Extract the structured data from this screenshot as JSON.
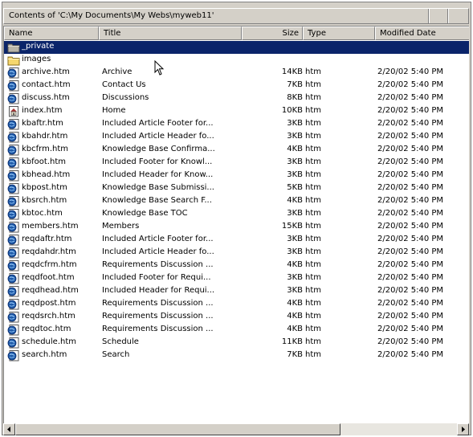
{
  "window": {
    "title": "Contents of 'C:\\My Documents\\My Webs\\myweb11'"
  },
  "columns": {
    "name": "Name",
    "title": "Title",
    "size": "Size",
    "type": "Type",
    "modified": "Modified Date"
  },
  "colors": {
    "selection": "#0a246a",
    "face": "#d4d0c8",
    "folder": "#f5d76e",
    "page_icon": "#1e5aa8"
  },
  "rows": [
    {
      "icon": "folder-private-icon",
      "name": "_private",
      "title": "",
      "size": "",
      "type": "",
      "modified": "",
      "selected": true
    },
    {
      "icon": "folder-icon",
      "name": "images",
      "title": "",
      "size": "",
      "type": "",
      "modified": ""
    },
    {
      "icon": "html-page-icon",
      "name": "archive.htm",
      "title": "Archive",
      "size": "14KB",
      "type": "htm",
      "modified": "2/20/02 5:40 PM"
    },
    {
      "icon": "html-page-icon",
      "name": "contact.htm",
      "title": "Contact Us",
      "size": "7KB",
      "type": "htm",
      "modified": "2/20/02 5:40 PM"
    },
    {
      "icon": "html-page-icon",
      "name": "discuss.htm",
      "title": "Discussions",
      "size": "8KB",
      "type": "htm",
      "modified": "2/20/02 5:40 PM"
    },
    {
      "icon": "home-page-icon",
      "name": "index.htm",
      "title": "Home",
      "size": "10KB",
      "type": "htm",
      "modified": "2/20/02 5:40 PM"
    },
    {
      "icon": "html-page-icon",
      "name": "kbaftr.htm",
      "title": "Included Article Footer for...",
      "size": "3KB",
      "type": "htm",
      "modified": "2/20/02 5:40 PM"
    },
    {
      "icon": "html-page-icon",
      "name": "kbahdr.htm",
      "title": "Included Article Header fo...",
      "size": "3KB",
      "type": "htm",
      "modified": "2/20/02 5:40 PM"
    },
    {
      "icon": "html-page-icon",
      "name": "kbcfrm.htm",
      "title": "Knowledge Base Confirma...",
      "size": "4KB",
      "type": "htm",
      "modified": "2/20/02 5:40 PM"
    },
    {
      "icon": "html-page-icon",
      "name": "kbfoot.htm",
      "title": "Included Footer for Knowl...",
      "size": "3KB",
      "type": "htm",
      "modified": "2/20/02 5:40 PM"
    },
    {
      "icon": "html-page-icon",
      "name": "kbhead.htm",
      "title": "Included Header for Know...",
      "size": "3KB",
      "type": "htm",
      "modified": "2/20/02 5:40 PM"
    },
    {
      "icon": "html-page-icon",
      "name": "kbpost.htm",
      "title": "Knowledge Base Submissi...",
      "size": "5KB",
      "type": "htm",
      "modified": "2/20/02 5:40 PM"
    },
    {
      "icon": "html-page-icon",
      "name": "kbsrch.htm",
      "title": "Knowledge Base Search F...",
      "size": "4KB",
      "type": "htm",
      "modified": "2/20/02 5:40 PM"
    },
    {
      "icon": "html-page-icon",
      "name": "kbtoc.htm",
      "title": "Knowledge Base TOC",
      "size": "3KB",
      "type": "htm",
      "modified": "2/20/02 5:40 PM"
    },
    {
      "icon": "html-page-icon",
      "name": "members.htm",
      "title": "Members",
      "size": "15KB",
      "type": "htm",
      "modified": "2/20/02 5:40 PM"
    },
    {
      "icon": "html-page-icon",
      "name": "reqdaftr.htm",
      "title": "Included Article Footer for...",
      "size": "3KB",
      "type": "htm",
      "modified": "2/20/02 5:40 PM"
    },
    {
      "icon": "html-page-icon",
      "name": "reqdahdr.htm",
      "title": "Included Article Header fo...",
      "size": "3KB",
      "type": "htm",
      "modified": "2/20/02 5:40 PM"
    },
    {
      "icon": "html-page-icon",
      "name": "reqdcfrm.htm",
      "title": "Requirements Discussion ...",
      "size": "4KB",
      "type": "htm",
      "modified": "2/20/02 5:40 PM"
    },
    {
      "icon": "html-page-icon",
      "name": "reqdfoot.htm",
      "title": "Included Footer for Requi...",
      "size": "3KB",
      "type": "htm",
      "modified": "2/20/02 5:40 PM"
    },
    {
      "icon": "html-page-icon",
      "name": "reqdhead.htm",
      "title": "Included Header for Requi...",
      "size": "3KB",
      "type": "htm",
      "modified": "2/20/02 5:40 PM"
    },
    {
      "icon": "html-page-icon",
      "name": "reqdpost.htm",
      "title": "Requirements Discussion ...",
      "size": "4KB",
      "type": "htm",
      "modified": "2/20/02 5:40 PM"
    },
    {
      "icon": "html-page-icon",
      "name": "reqdsrch.htm",
      "title": "Requirements Discussion ...",
      "size": "4KB",
      "type": "htm",
      "modified": "2/20/02 5:40 PM"
    },
    {
      "icon": "html-page-icon",
      "name": "reqdtoc.htm",
      "title": "Requirements Discussion ...",
      "size": "4KB",
      "type": "htm",
      "modified": "2/20/02 5:40 PM"
    },
    {
      "icon": "html-page-icon",
      "name": "schedule.htm",
      "title": "Schedule",
      "size": "11KB",
      "type": "htm",
      "modified": "2/20/02 5:40 PM"
    },
    {
      "icon": "html-page-icon",
      "name": "search.htm",
      "title": "Search",
      "size": "7KB",
      "type": "htm",
      "modified": "2/20/02 5:40 PM"
    }
  ]
}
